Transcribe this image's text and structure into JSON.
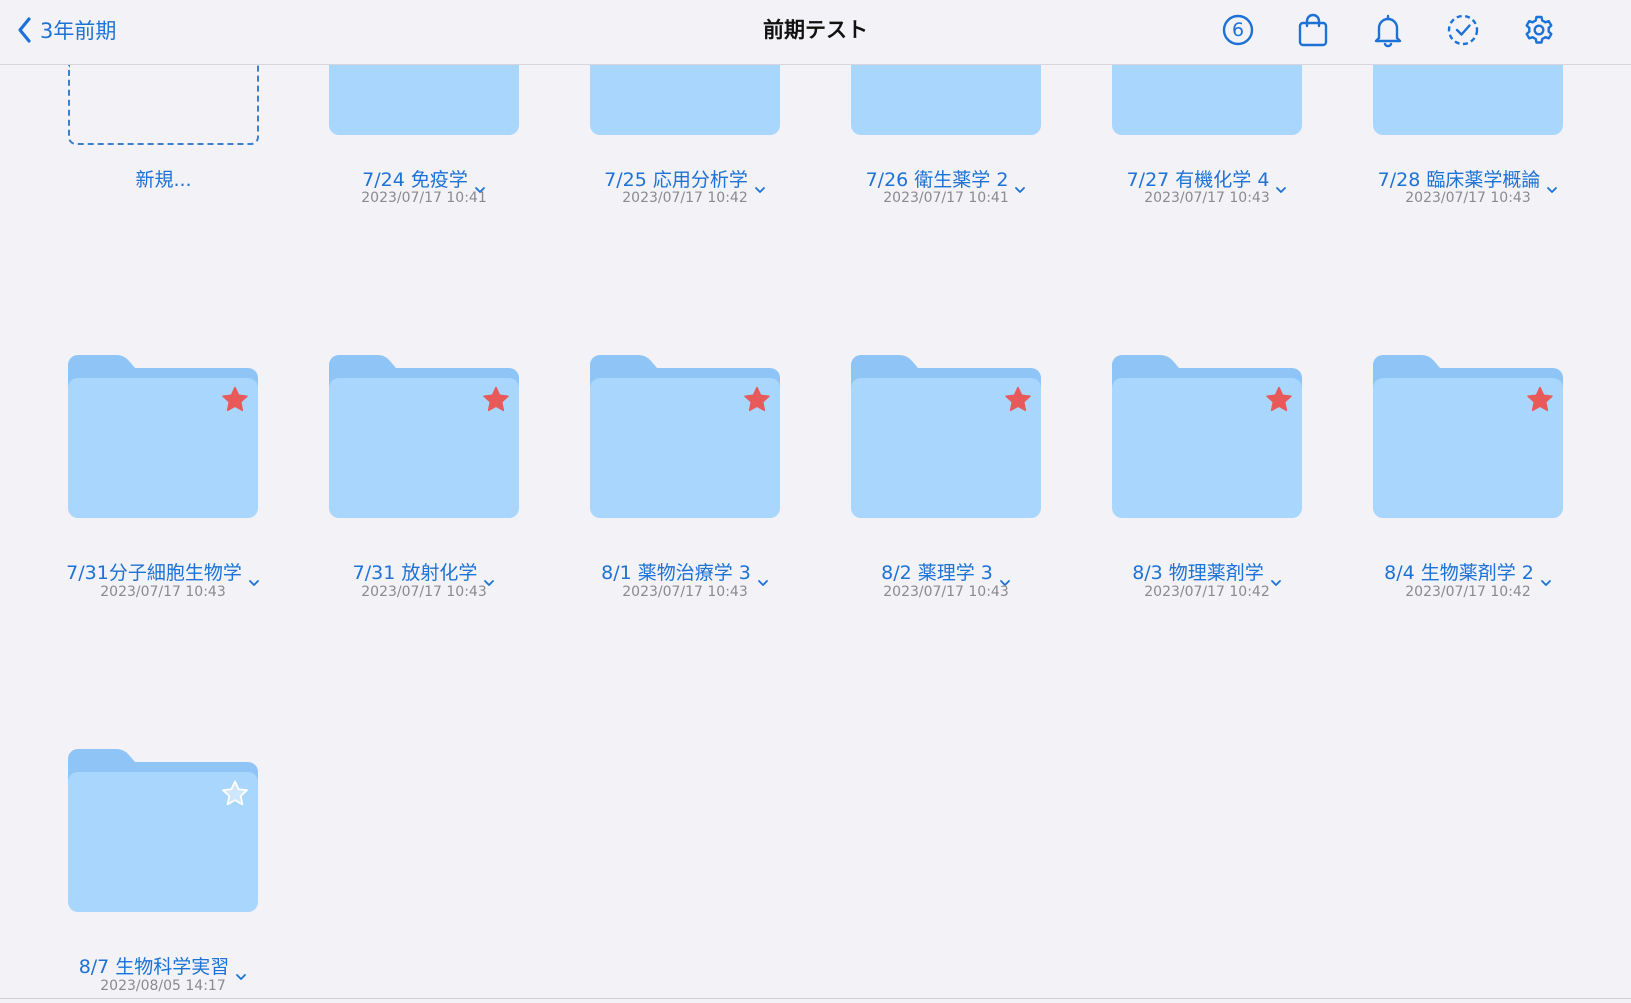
{
  "nav": {
    "back_label": "3年前期",
    "title": "前期テスト",
    "badge_count": "6"
  },
  "colors": {
    "accent": "#1c72d6",
    "folder_front": "#a9d6fd",
    "folder_back": "#8ec4f6",
    "star_favorite": "#e85a5a"
  },
  "new_item": {
    "label": "新規..."
  },
  "folders": [
    {
      "name": "7/24 免疫学",
      "date": "2023/07/17 10:41",
      "favorite": true
    },
    {
      "name": "7/25 応用分析学",
      "date": "2023/07/17 10:42",
      "favorite": true
    },
    {
      "name": "7/26 衛生薬学 2",
      "date": "2023/07/17 10:41",
      "favorite": true
    },
    {
      "name": "7/27 有機化学 4",
      "date": "2023/07/17 10:43",
      "favorite": true
    },
    {
      "name": "7/28 臨床薬学概論",
      "date": "2023/07/17 10:43",
      "favorite": true
    },
    {
      "name": "7/31分子細胞生物学",
      "date": "2023/07/17 10:43",
      "favorite": true
    },
    {
      "name": "7/31 放射化学",
      "date": "2023/07/17 10:43",
      "favorite": true
    },
    {
      "name": "8/1 薬物治療学 3",
      "date": "2023/07/17 10:43",
      "favorite": true
    },
    {
      "name": "8/2 薬理学 3",
      "date": "2023/07/17 10:43",
      "favorite": true
    },
    {
      "name": "8/3 物理薬剤学",
      "date": "2023/07/17 10:42",
      "favorite": true
    },
    {
      "name": "8/4 生物薬剤学 2",
      "date": "2023/07/17 10:42",
      "favorite": true
    },
    {
      "name": "8/7 生物科学実習",
      "date": "2023/08/05 14:17",
      "favorite": false
    }
  ]
}
